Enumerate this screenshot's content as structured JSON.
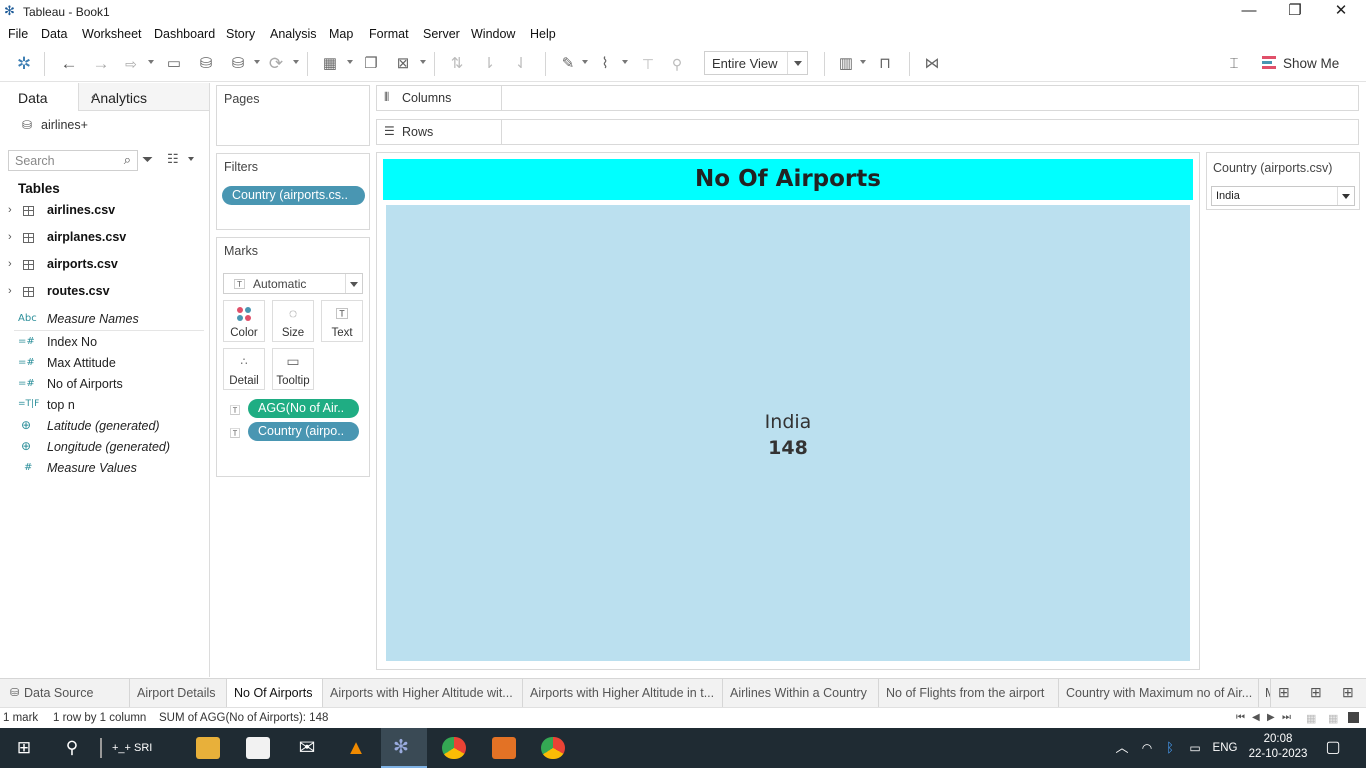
{
  "window": {
    "title": "Tableau - Book1"
  },
  "menu": [
    "File",
    "Data",
    "Worksheet",
    "Dashboard",
    "Story",
    "Analysis",
    "Map",
    "Format",
    "Server",
    "Window",
    "Help"
  ],
  "toolbar": {
    "fit_value": "Entire View",
    "show_me_label": "Show Me"
  },
  "datapane": {
    "tab_data": "Data",
    "tab_analytics": "Analytics",
    "datasource": "airlines+",
    "search_placeholder": "Search",
    "tables_heading": "Tables",
    "tables": [
      "airlines.csv",
      "airplanes.csv",
      "airports.csv",
      "routes.csv"
    ],
    "fields": [
      {
        "type": "Abc",
        "name": "Measure Names",
        "italic": true
      },
      {
        "type": "=#",
        "name": "Index No",
        "italic": false
      },
      {
        "type": "=#",
        "name": "Max Attitude",
        "italic": false
      },
      {
        "type": "=#",
        "name": "No of Airports",
        "italic": false
      },
      {
        "type": "=T|F",
        "name": "top n",
        "italic": false
      },
      {
        "type": "globe",
        "name": "Latitude (generated)",
        "italic": true
      },
      {
        "type": "globe",
        "name": "Longitude (generated)",
        "italic": true
      },
      {
        "type": "#",
        "name": "Measure Values",
        "italic": true
      }
    ]
  },
  "cards": {
    "pages_title": "Pages",
    "filters_title": "Filters",
    "filter_pill": "Country (airports.cs..",
    "marks_title": "Marks",
    "mark_type": "Automatic",
    "mark_buttons": [
      "Color",
      "Size",
      "Text",
      "Detail",
      "Tooltip"
    ],
    "mark_pills": [
      "AGG(No of Air..",
      "Country (airpo.."
    ]
  },
  "shelves": {
    "columns": "Columns",
    "rows": "Rows"
  },
  "viz": {
    "title": "No Of Airports",
    "country": "India",
    "value": "148"
  },
  "quick_filter": {
    "title": "Country (airports.csv)",
    "value": "India"
  },
  "sheet_tabs": [
    "Data Source",
    "Airport Details",
    "No Of Airports",
    "Airports with Higher Altitude wit...",
    "Airports with Higher Altitude in t...",
    "Airlines Within a Country",
    "No of Flights from the airport",
    "Country with Maximum no of Air...",
    "M"
  ],
  "active_tab": "No Of Airports",
  "status": {
    "marks": "1 mark",
    "dims": "1 row by 1 column",
    "sum": "SUM of AGG(No of Airports): 148"
  },
  "taskbar": {
    "search_app_label": "+_+ SRI",
    "lang": "ENG",
    "time": "20:08",
    "date": "22-10-2023"
  },
  "colors": {
    "title_band": "#00ffff",
    "mark_fill": "#bbe0ef",
    "pill_blue": "#4996b2",
    "pill_green": "#1fad83",
    "taskbar": "#1f2b33"
  }
}
